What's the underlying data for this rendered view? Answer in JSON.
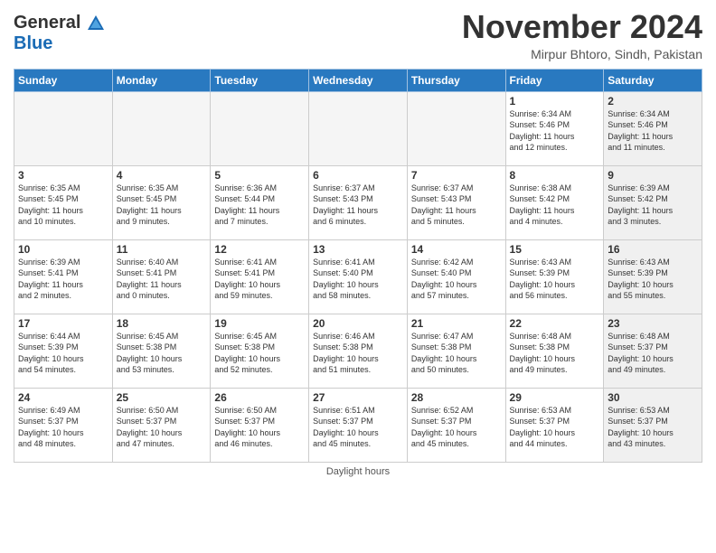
{
  "header": {
    "logo_line1": "General",
    "logo_line2": "Blue",
    "month_title": "November 2024",
    "subtitle": "Mirpur Bhtoro, Sindh, Pakistan"
  },
  "weekdays": [
    "Sunday",
    "Monday",
    "Tuesday",
    "Wednesday",
    "Thursday",
    "Friday",
    "Saturday"
  ],
  "footer": {
    "note": "Daylight hours"
  },
  "weeks": [
    [
      {
        "day": "",
        "info": "",
        "empty": true
      },
      {
        "day": "",
        "info": "",
        "empty": true
      },
      {
        "day": "",
        "info": "",
        "empty": true
      },
      {
        "day": "",
        "info": "",
        "empty": true
      },
      {
        "day": "",
        "info": "",
        "empty": true
      },
      {
        "day": "1",
        "info": "Sunrise: 6:34 AM\nSunset: 5:46 PM\nDaylight: 11 hours\nand 12 minutes.",
        "empty": false,
        "shaded": false
      },
      {
        "day": "2",
        "info": "Sunrise: 6:34 AM\nSunset: 5:46 PM\nDaylight: 11 hours\nand 11 minutes.",
        "empty": false,
        "shaded": true
      }
    ],
    [
      {
        "day": "3",
        "info": "Sunrise: 6:35 AM\nSunset: 5:45 PM\nDaylight: 11 hours\nand 10 minutes.",
        "empty": false,
        "shaded": false
      },
      {
        "day": "4",
        "info": "Sunrise: 6:35 AM\nSunset: 5:45 PM\nDaylight: 11 hours\nand 9 minutes.",
        "empty": false,
        "shaded": false
      },
      {
        "day": "5",
        "info": "Sunrise: 6:36 AM\nSunset: 5:44 PM\nDaylight: 11 hours\nand 7 minutes.",
        "empty": false,
        "shaded": false
      },
      {
        "day": "6",
        "info": "Sunrise: 6:37 AM\nSunset: 5:43 PM\nDaylight: 11 hours\nand 6 minutes.",
        "empty": false,
        "shaded": false
      },
      {
        "day": "7",
        "info": "Sunrise: 6:37 AM\nSunset: 5:43 PM\nDaylight: 11 hours\nand 5 minutes.",
        "empty": false,
        "shaded": false
      },
      {
        "day": "8",
        "info": "Sunrise: 6:38 AM\nSunset: 5:42 PM\nDaylight: 11 hours\nand 4 minutes.",
        "empty": false,
        "shaded": false
      },
      {
        "day": "9",
        "info": "Sunrise: 6:39 AM\nSunset: 5:42 PM\nDaylight: 11 hours\nand 3 minutes.",
        "empty": false,
        "shaded": true
      }
    ],
    [
      {
        "day": "10",
        "info": "Sunrise: 6:39 AM\nSunset: 5:41 PM\nDaylight: 11 hours\nand 2 minutes.",
        "empty": false,
        "shaded": false
      },
      {
        "day": "11",
        "info": "Sunrise: 6:40 AM\nSunset: 5:41 PM\nDaylight: 11 hours\nand 0 minutes.",
        "empty": false,
        "shaded": false
      },
      {
        "day": "12",
        "info": "Sunrise: 6:41 AM\nSunset: 5:41 PM\nDaylight: 10 hours\nand 59 minutes.",
        "empty": false,
        "shaded": false
      },
      {
        "day": "13",
        "info": "Sunrise: 6:41 AM\nSunset: 5:40 PM\nDaylight: 10 hours\nand 58 minutes.",
        "empty": false,
        "shaded": false
      },
      {
        "day": "14",
        "info": "Sunrise: 6:42 AM\nSunset: 5:40 PM\nDaylight: 10 hours\nand 57 minutes.",
        "empty": false,
        "shaded": false
      },
      {
        "day": "15",
        "info": "Sunrise: 6:43 AM\nSunset: 5:39 PM\nDaylight: 10 hours\nand 56 minutes.",
        "empty": false,
        "shaded": false
      },
      {
        "day": "16",
        "info": "Sunrise: 6:43 AM\nSunset: 5:39 PM\nDaylight: 10 hours\nand 55 minutes.",
        "empty": false,
        "shaded": true
      }
    ],
    [
      {
        "day": "17",
        "info": "Sunrise: 6:44 AM\nSunset: 5:39 PM\nDaylight: 10 hours\nand 54 minutes.",
        "empty": false,
        "shaded": false
      },
      {
        "day": "18",
        "info": "Sunrise: 6:45 AM\nSunset: 5:38 PM\nDaylight: 10 hours\nand 53 minutes.",
        "empty": false,
        "shaded": false
      },
      {
        "day": "19",
        "info": "Sunrise: 6:45 AM\nSunset: 5:38 PM\nDaylight: 10 hours\nand 52 minutes.",
        "empty": false,
        "shaded": false
      },
      {
        "day": "20",
        "info": "Sunrise: 6:46 AM\nSunset: 5:38 PM\nDaylight: 10 hours\nand 51 minutes.",
        "empty": false,
        "shaded": false
      },
      {
        "day": "21",
        "info": "Sunrise: 6:47 AM\nSunset: 5:38 PM\nDaylight: 10 hours\nand 50 minutes.",
        "empty": false,
        "shaded": false
      },
      {
        "day": "22",
        "info": "Sunrise: 6:48 AM\nSunset: 5:38 PM\nDaylight: 10 hours\nand 49 minutes.",
        "empty": false,
        "shaded": false
      },
      {
        "day": "23",
        "info": "Sunrise: 6:48 AM\nSunset: 5:37 PM\nDaylight: 10 hours\nand 49 minutes.",
        "empty": false,
        "shaded": true
      }
    ],
    [
      {
        "day": "24",
        "info": "Sunrise: 6:49 AM\nSunset: 5:37 PM\nDaylight: 10 hours\nand 48 minutes.",
        "empty": false,
        "shaded": false
      },
      {
        "day": "25",
        "info": "Sunrise: 6:50 AM\nSunset: 5:37 PM\nDaylight: 10 hours\nand 47 minutes.",
        "empty": false,
        "shaded": false
      },
      {
        "day": "26",
        "info": "Sunrise: 6:50 AM\nSunset: 5:37 PM\nDaylight: 10 hours\nand 46 minutes.",
        "empty": false,
        "shaded": false
      },
      {
        "day": "27",
        "info": "Sunrise: 6:51 AM\nSunset: 5:37 PM\nDaylight: 10 hours\nand 45 minutes.",
        "empty": false,
        "shaded": false
      },
      {
        "day": "28",
        "info": "Sunrise: 6:52 AM\nSunset: 5:37 PM\nDaylight: 10 hours\nand 45 minutes.",
        "empty": false,
        "shaded": false
      },
      {
        "day": "29",
        "info": "Sunrise: 6:53 AM\nSunset: 5:37 PM\nDaylight: 10 hours\nand 44 minutes.",
        "empty": false,
        "shaded": false
      },
      {
        "day": "30",
        "info": "Sunrise: 6:53 AM\nSunset: 5:37 PM\nDaylight: 10 hours\nand 43 minutes.",
        "empty": false,
        "shaded": true
      }
    ]
  ]
}
